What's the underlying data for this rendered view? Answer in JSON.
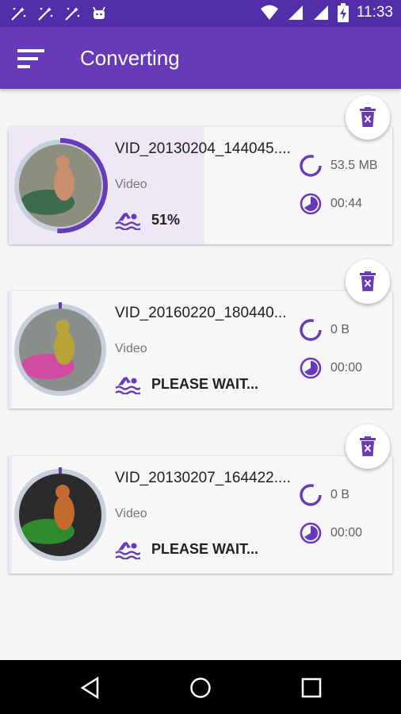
{
  "status_bar": {
    "time": "11:33",
    "left_icons": [
      "wand-icon",
      "wand-icon",
      "wand-icon",
      "android-icon"
    ],
    "right_icons": [
      "wifi-icon",
      "signal-icon",
      "signal-icon",
      "battery-charging-icon"
    ]
  },
  "app_bar": {
    "title": "Converting",
    "menu_icon": "sort-menu-icon",
    "background": "#673ab7",
    "status_background": "#512da8"
  },
  "accent": "#673ab7",
  "items": [
    {
      "filename": "VID_20130204_144045....",
      "type": "Video",
      "status": "51%",
      "progress": 0.51,
      "size": "53.5 MB",
      "duration": "00:44",
      "thumb_colors": [
        "#8d8d80",
        "#3f6b4d",
        "#c98f6d"
      ]
    },
    {
      "filename": "VID_20160220_180440...",
      "type": "Video",
      "status": "PLEASE WAIT...",
      "progress": 0,
      "size": "0 B",
      "duration": "00:00",
      "thumb_colors": [
        "#8a8f8c",
        "#d24aa2",
        "#b8a338"
      ]
    },
    {
      "filename": "VID_20130207_164422....",
      "type": "Video",
      "status": "PLEASE WAIT...",
      "progress": 0,
      "size": "0 B",
      "duration": "00:00",
      "thumb_colors": [
        "#2b2b2b",
        "#2e8b2e",
        "#c36a2e"
      ]
    }
  ]
}
